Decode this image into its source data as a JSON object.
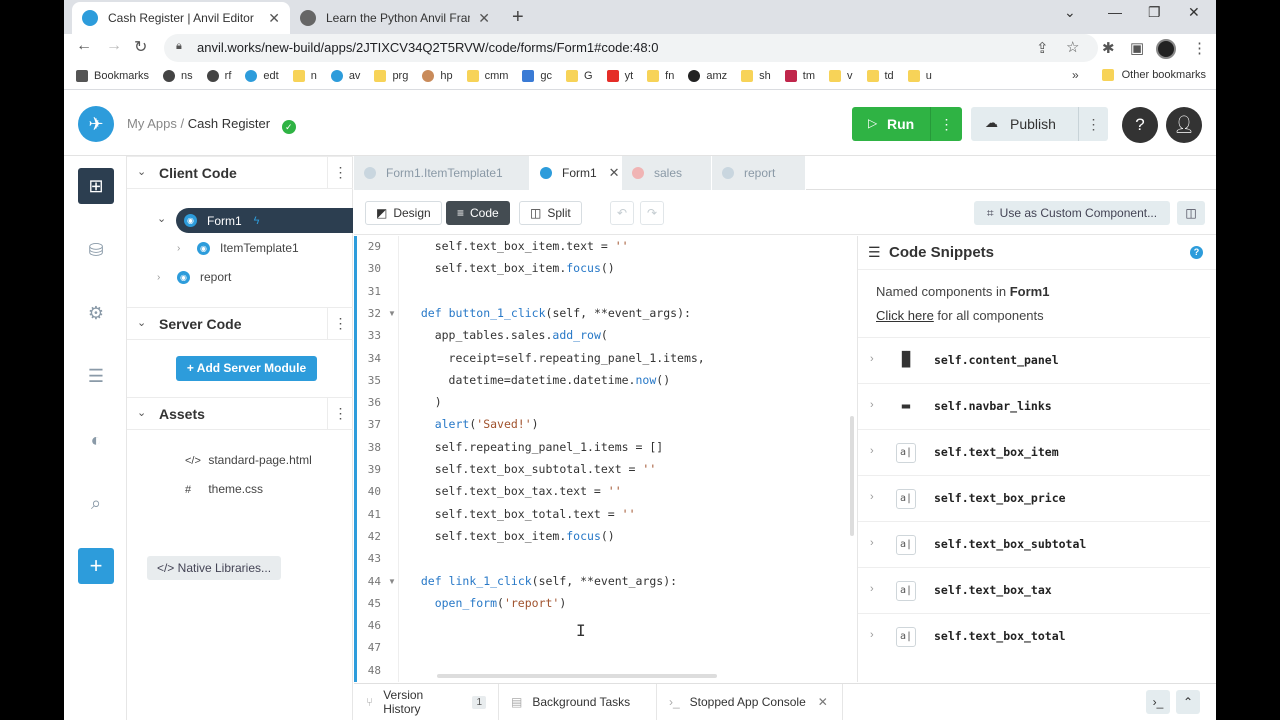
{
  "browser": {
    "tabs": [
      {
        "title": "Cash Register | Anvil Editor",
        "close": "✕"
      },
      {
        "title": "Learn the Python Anvil Framewo",
        "close": "✕"
      }
    ],
    "new_tab": "+",
    "url": "anvil.works/new-build/apps/2JTIXCV34Q2T5RVW/code/forms/Form1#code:48:0",
    "bookmarks": [
      "Bookmarks",
      "ns",
      "rf",
      "edt",
      "n",
      "av",
      "prg",
      "hp",
      "cmm",
      "gc",
      "G",
      "yt",
      "fn",
      "amz",
      "sh",
      "tm",
      "v",
      "td",
      "u"
    ],
    "bookmarks_more": "»",
    "other_bookmarks": "Other bookmarks"
  },
  "header": {
    "my_apps": "My Apps",
    "separator": "/",
    "app_name": "Cash Register",
    "run_label": "Run",
    "publish_label": "Publish",
    "help_icon": "?",
    "more_glyph": "⋮"
  },
  "tree": {
    "client_code": "Client Code",
    "form1": "Form1",
    "item_template": "ItemTemplate1",
    "report": "report",
    "server_code": "Server Code",
    "add_server_module": "+ Add Server Module",
    "assets": "Assets",
    "asset_files": [
      {
        "glyph": "</>",
        "name": "standard-page.html"
      },
      {
        "glyph": "#",
        "name": "theme.css"
      }
    ],
    "native_libraries": "</> Native Libraries..."
  },
  "editor_tabs": [
    {
      "label": "Form1.ItemTemplate1",
      "type": "form"
    },
    {
      "label": "Form1",
      "type": "form",
      "active": true
    },
    {
      "label": "sales",
      "type": "table"
    },
    {
      "label": "report",
      "type": "form"
    }
  ],
  "mode_bar": {
    "design": "Design",
    "code": "Code",
    "split": "Split",
    "custom_component": "Use as Custom Component..."
  },
  "code": {
    "line_numbers": [
      "29",
      "30",
      "31",
      "32",
      "33",
      "34",
      "35",
      "36",
      "37",
      "38",
      "39",
      "40",
      "41",
      "42",
      "43",
      "44",
      "45",
      "46",
      "47",
      "48"
    ],
    "lines": [
      "    self.text_box_item.text = ''",
      "    self.text_box_item.focus()",
      "",
      "  def button_1_click(self, **event_args):",
      "    app_tables.sales.add_row(",
      "      receipt=self.repeating_panel_1.items,",
      "      datetime=datetime.datetime.now()",
      "    )",
      "    alert('Saved!')",
      "    self.repeating_panel_1.items = []",
      "    self.text_box_subtotal.text = ''",
      "    self.text_box_tax.text = ''",
      "    self.text_box_total.text = ''",
      "    self.text_box_item.focus()",
      "",
      "  def link_1_click(self, **event_args):",
      "    open_form('report')",
      "",
      "",
      ""
    ]
  },
  "snippets": {
    "title": "Code Snippets",
    "help": "?",
    "named_prefix": "Named components in",
    "named_form": "Form1",
    "click_here": "Click here",
    "click_suffix": "for all components",
    "components": [
      {
        "name": "self.content_panel",
        "icon": "column-panel-icon"
      },
      {
        "name": "self.navbar_links",
        "icon": "flow-panel-icon"
      },
      {
        "name": "self.text_box_item",
        "icon": "textbox-icon"
      },
      {
        "name": "self.text_box_price",
        "icon": "textbox-icon"
      },
      {
        "name": "self.text_box_subtotal",
        "icon": "textbox-icon"
      },
      {
        "name": "self.text_box_tax",
        "icon": "textbox-icon"
      },
      {
        "name": "self.text_box_total",
        "icon": "textbox-icon"
      }
    ]
  },
  "bottom_bar": {
    "version_history": "Version History",
    "version_count": "1",
    "background_tasks": "Background Tasks",
    "app_console": "Stopped App Console"
  },
  "colors": {
    "accent": "#2d9cdb",
    "run_green": "#2fb344",
    "dark": "#2c3e50"
  }
}
